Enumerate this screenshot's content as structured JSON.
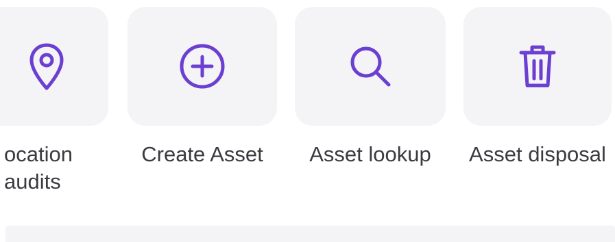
{
  "colors": {
    "accent": "#6a3fd1",
    "tile_bg": "#f4f3f6",
    "label_text": "#3b3a40"
  },
  "actions": [
    {
      "label": "ocation\naudits",
      "icon": "location-pin-icon"
    },
    {
      "label": "Create Asset",
      "icon": "plus-circle-icon"
    },
    {
      "label": "Asset lookup",
      "icon": "search-icon"
    },
    {
      "label": "Asset disposal",
      "icon": "trash-icon"
    }
  ]
}
